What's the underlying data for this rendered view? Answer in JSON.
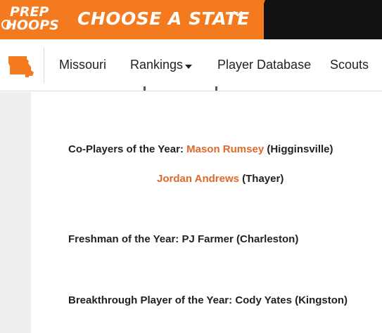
{
  "brand": {
    "logo_line1": "PREP",
    "logo_line2": "HOOPS",
    "choose_label": "CHOOSE A STATE",
    "accent_color": "#f47a1f",
    "link_color": "#e0692a"
  },
  "nav": {
    "state_icon": "missouri-state-icon",
    "items": [
      {
        "label": "Missouri"
      },
      {
        "label": "Rankings"
      },
      {
        "label": "Player Database"
      },
      {
        "label": "Scouts"
      }
    ]
  },
  "awards": [
    {
      "prefix": "Co-Players of the Year: ",
      "name": "Mason Rumsey",
      "suffix": " (Higginsville)"
    },
    {
      "prefix": "",
      "name": "Jordan Andrews",
      "suffix": " (Thayer)"
    },
    {
      "prefix": "Freshman of the Year: ",
      "name": "",
      "suffix": "PJ Farmer (Charleston)"
    },
    {
      "prefix": "Breakthrough Player of the Year: ",
      "name": "",
      "suffix": "Cody Yates (Kingston)"
    }
  ]
}
